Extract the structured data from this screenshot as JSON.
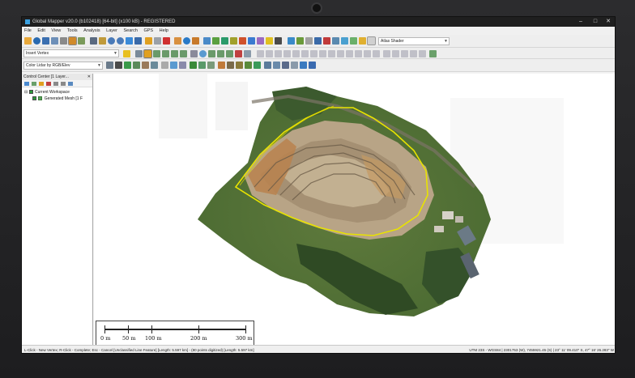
{
  "window": {
    "title": "Global Mapper v20.0 (b102418) [64-bit] (x100 kB) - REGISTERED",
    "minimize_label": "–",
    "maximize_label": "□",
    "close_label": "✕"
  },
  "menu": [
    "File",
    "Edit",
    "View",
    "Tools",
    "Analysis",
    "Layer",
    "Search",
    "GPS",
    "Help"
  ],
  "toolbar": {
    "digitizer_mode": "Insert Vertex",
    "shader": "Atlas Shader",
    "color_mode": "Color Lidar by RGB/Elev"
  },
  "control_center": {
    "title": "Control Center [1 Layer...",
    "close_label": "✕",
    "items": [
      {
        "label": "Current Workspace",
        "checked": true
      },
      {
        "label": "Generated Mesh [1 F",
        "checked": true
      }
    ]
  },
  "scale_bar": {
    "labels": [
      "0 m",
      "50 m",
      "100 m",
      "200 m",
      "300 m"
    ]
  },
  "status": {
    "left": "L-Click - New Vertex; R-Click - Complete; Esc - Cancel [Unclassified Line Feature] [Length: 5.597 km] - (80 points digitized) [Length: 5.597 km]",
    "right": "UTM 23S - WGS84 | 2301753 (W), 7455921.45 (S) | 23° 11' 09.410\" S, 47° 16' 26.283\" W"
  },
  "colors": {
    "accent": "#3aa0e0",
    "vector_line": "#e8e300"
  }
}
